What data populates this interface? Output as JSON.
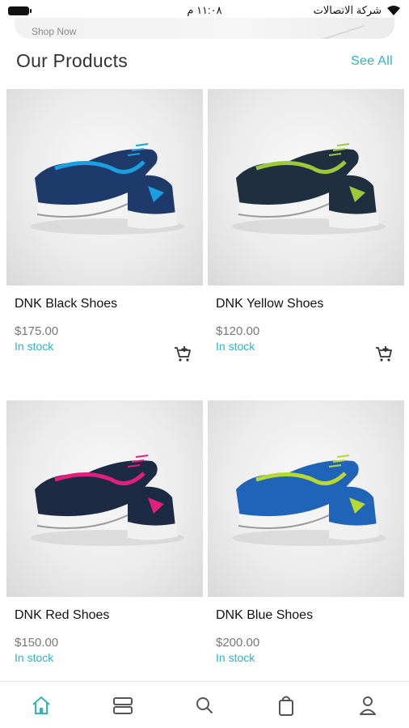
{
  "status_bar": {
    "time": "١١:٠٨ م",
    "carrier": "شركة الاتصالات"
  },
  "banner": {
    "shop_now_label": "Shop Now"
  },
  "section": {
    "title": "Our Products",
    "see_all_label": "See All"
  },
  "colors": {
    "accent": "#2fb4c0",
    "text": "#111111",
    "price": "#777777"
  },
  "products": [
    {
      "name": "DNK Black Shoes",
      "price": "$175.00",
      "stock": "In stock",
      "shoe_color": "#1d3a6b",
      "accent_color": "#1aa0e0",
      "cart_icon": "add-to-cart-icon"
    },
    {
      "name": "DNK Yellow Shoes",
      "price": "$120.00",
      "stock": "In stock",
      "shoe_color": "#1f2f3f",
      "accent_color": "#9cc93a",
      "cart_icon": "add-to-cart-icon"
    },
    {
      "name": "DNK Red Shoes",
      "price": "$150.00",
      "stock": "In stock",
      "shoe_color": "#1c2a44",
      "accent_color": "#e0207a",
      "cart_icon": null
    },
    {
      "name": "DNK Blue Shoes",
      "price": "$200.00",
      "stock": "In stock",
      "shoe_color": "#1f64b8",
      "accent_color": "#b8d830",
      "cart_icon": null
    }
  ],
  "bottom_nav": {
    "items": [
      "home-icon",
      "categories-icon",
      "search-icon",
      "bag-icon",
      "profile-icon"
    ],
    "active": "home-icon"
  }
}
